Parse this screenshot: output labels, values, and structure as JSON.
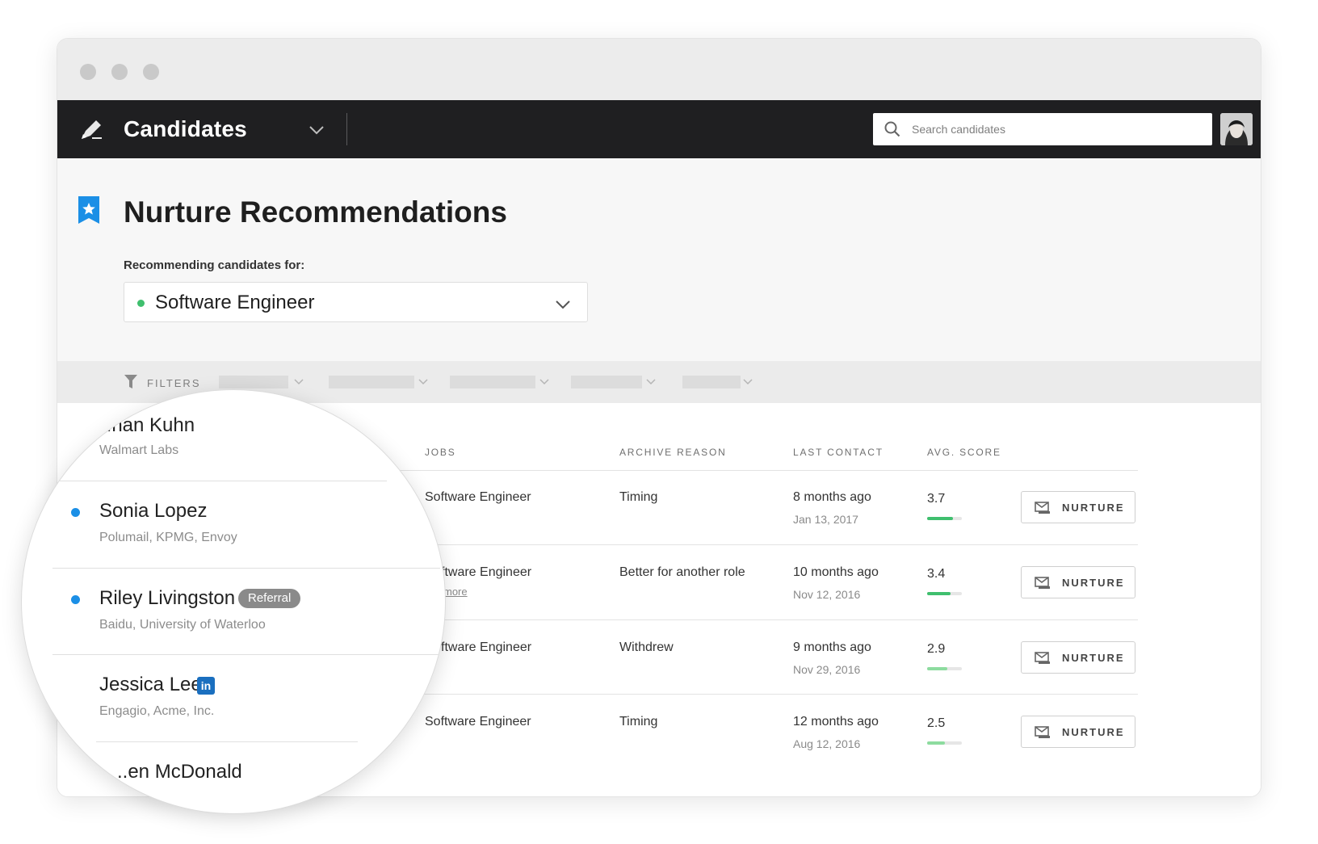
{
  "app": {
    "title": "Candidates"
  },
  "search": {
    "placeholder": "Search candidates"
  },
  "page": {
    "title": "Nurture Recommendations",
    "recommending_label": "Recommending candidates for:",
    "selected_job": "Software Engineer"
  },
  "filters": {
    "label": "FILTERS"
  },
  "table": {
    "columns": {
      "jobs": "JOBS",
      "archive_reason": "ARCHIVE REASON",
      "last_contact": "LAST CONTACT",
      "avg_score": "AVG. SCORE"
    },
    "rows": [
      {
        "job": "Software Engineer",
        "reason": "Timing",
        "last_contact": "8 months ago",
        "date": "Jan 13, 2017",
        "score": "3.7",
        "score_fraction": 0.74,
        "score_color": "#3fbf6e",
        "action": "NURTURE"
      },
      {
        "job": "ftware Engineer",
        "job_more": "more",
        "reason": "Better for another role",
        "last_contact": "10 months ago",
        "date": "Nov 12, 2016",
        "score": "3.4",
        "score_fraction": 0.68,
        "score_color": "#3fbf6e",
        "action": "NURTURE"
      },
      {
        "job": "ftware Engineer",
        "reason": "Withdrew",
        "last_contact": "9 months ago",
        "date": "Nov 29, 2016",
        "score": "2.9",
        "score_fraction": 0.58,
        "score_color": "#8ddc9f",
        "action": "NURTURE"
      },
      {
        "job": "Software Engineer",
        "reason": "Timing",
        "last_contact": "12 months ago",
        "date": "Aug 12, 2016",
        "score": "2.5",
        "score_fraction": 0.5,
        "score_color": "#8ddc9f",
        "action": "NURTURE"
      }
    ]
  },
  "magnified_candidates": [
    {
      "name": "..nan Kuhn",
      "companies": "Walmart Labs"
    },
    {
      "name": "Sonia Lopez",
      "companies": "Polumail, KPMG, Envoy",
      "dot_color": "#1b8fe6"
    },
    {
      "name": "Riley Livingston",
      "companies": "Baidu, University of Waterloo",
      "badge": "Referral",
      "dot_color": "#1b8fe6"
    },
    {
      "name": "Jessica Lee",
      "companies": "Engagio, Acme, Inc.",
      "badge_icon": "in"
    },
    {
      "name": "..en McDonald"
    }
  ],
  "colors": {
    "accent_blue": "#1b8fe6",
    "topbar": "#1f1f21",
    "green": "#3fbf6e"
  }
}
